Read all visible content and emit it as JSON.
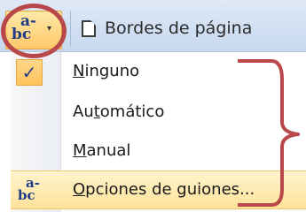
{
  "toolbar": {
    "hyphenation_icon_top": "a-",
    "hyphenation_icon_bottom": "bc",
    "dropdown_arrow": "▾",
    "page_borders_label": "Bordes de página"
  },
  "menu": {
    "items": [
      {
        "label_pre": "",
        "label_accel": "N",
        "label_post": "inguno",
        "checked": true
      },
      {
        "label_pre": "Au",
        "label_accel": "t",
        "label_post": "omático",
        "checked": false
      },
      {
        "label_pre": "",
        "label_accel": "M",
        "label_post": "anual",
        "checked": false
      }
    ],
    "options": {
      "label_pre": "",
      "label_accel": "O",
      "label_post": "pciones de guiones..."
    },
    "check_glyph": "✓"
  },
  "colors": {
    "annotation": "#b8484a",
    "highlight": "#ffc86a",
    "icon_blue": "#1f3c88"
  },
  "icons": [
    "hyphenation-icon",
    "dropdown-arrow-icon",
    "page-borders-icon",
    "checkmark-icon"
  ]
}
